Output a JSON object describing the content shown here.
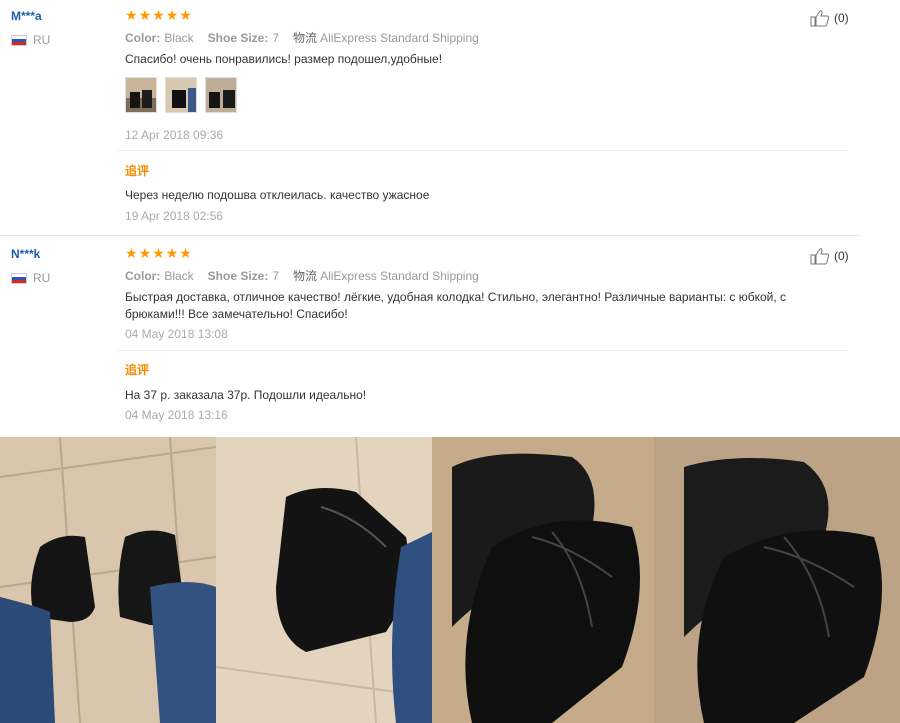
{
  "reviews": [
    {
      "username": "M***a",
      "country": "RU",
      "stars": 5,
      "color_label": "Color:",
      "color_value": "Black",
      "size_label": "Shoe Size:",
      "size_value": "7",
      "shipping_label": "物流",
      "shipping_value": "AliExpress Standard Shipping",
      "text": "Спасибо! очень понравились! размер подошел,удобные!",
      "date": "12 Apr 2018 09:36",
      "additional_label": "追评",
      "additional_text": "Через неделю подошва отклеилась. качество ужасное",
      "additional_date": "19 Apr 2018 02:56",
      "likes": "(0)"
    },
    {
      "username": "N***k",
      "country": "RU",
      "stars": 5,
      "color_label": "Color:",
      "color_value": "Black",
      "size_label": "Shoe Size:",
      "size_value": "7",
      "shipping_label": "物流",
      "shipping_value": "AliExpress Standard Shipping",
      "text": "Быстрая доставка, отличное качество! лёгкие, удобная колодка! Стильно, элегантно! Различные варианты: с юбкой, с брюками!!! Все замечательно! Спасибо!",
      "date": "04 May 2018 13:08",
      "additional_label": "追评",
      "additional_text": "На 37 р. заказала 37р. Подошли идеально!",
      "additional_date": "04 May 2018 13:16",
      "likes": "(0)"
    }
  ],
  "colors": {
    "username": "#1b5ea8",
    "stars": "#ff9900",
    "additional": "#f38b00"
  },
  "icons": {
    "like": "thumbs-up-icon",
    "flag": "russia-flag-icon"
  }
}
